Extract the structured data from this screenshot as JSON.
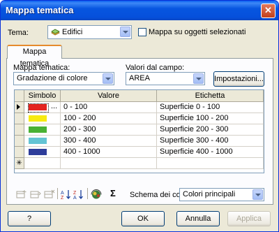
{
  "window": {
    "title": "Mappa tematica",
    "close": "✕"
  },
  "tema": {
    "label": "Tema:",
    "value": "Edifici"
  },
  "selected_only": {
    "label": "Mappa su oggetti selezionati"
  },
  "tab": {
    "label": "Mappa tematica"
  },
  "mappa_tematica": {
    "label": "Mappa tematica:",
    "value": "Gradazione di colore"
  },
  "campo": {
    "label": "Valori dal campo:",
    "value": "AREA"
  },
  "settings_button": "Impostazioni...",
  "grid": {
    "columns": [
      "Simbolo",
      "Valore",
      "Etichetta"
    ],
    "ellipsis": "...",
    "new_row_marker": "✳",
    "rows": [
      {
        "color": "#e42420",
        "valore": "0 - 100",
        "etichetta": "Superficie 0 - 100"
      },
      {
        "color": "#f7ea10",
        "valore": "100 - 200",
        "etichetta": "Superficie 100 - 200"
      },
      {
        "color": "#49b133",
        "valore": "200 - 300",
        "etichetta": "Superficie 200 - 300"
      },
      {
        "color": "#64c4d4",
        "valore": "300 - 400",
        "etichetta": "Superficie 300 - 400"
      },
      {
        "color": "#2e3d9a",
        "valore": "400 - 1000",
        "etichetta": "Superficie 400 - 1000"
      }
    ]
  },
  "toolbar": {
    "sigma": "Σ",
    "scheme_label": "Schema dei colori",
    "scheme_value": "Colori principali"
  },
  "buttons": {
    "help": "?",
    "ok": "OK",
    "cancel": "Annulla",
    "apply": "Applica"
  }
}
